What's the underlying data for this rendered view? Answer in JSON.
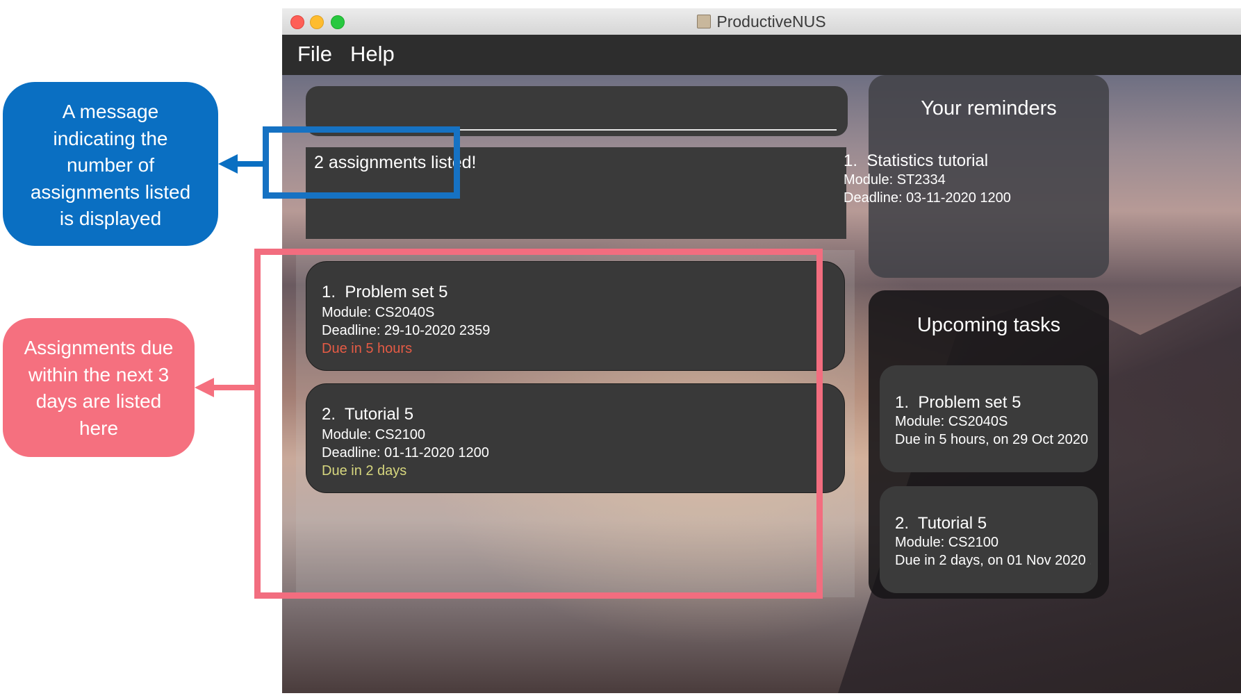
{
  "window": {
    "title": "ProductiveNUS"
  },
  "menu": {
    "items": [
      "File",
      "Help"
    ]
  },
  "command_box": {
    "value": ""
  },
  "result_display": {
    "text": "2 assignments listed!"
  },
  "assignment_list": [
    {
      "index": "1.",
      "name": "Problem set 5",
      "module": "Module: CS2040S",
      "deadline": "Deadline: 29-10-2020 2359",
      "due": "Due in 5 hours"
    },
    {
      "index": "2.",
      "name": "Tutorial 5",
      "module": "Module: CS2100",
      "deadline": "Deadline: 01-11-2020 1200",
      "due": "Due in 2 days"
    }
  ],
  "reminders": {
    "heading": "Your reminders",
    "items": [
      {
        "index": "1.",
        "name": "Statistics tutorial",
        "module": "Module: ST2334",
        "deadline": "Deadline: 03-11-2020 1200"
      }
    ]
  },
  "upcoming": {
    "heading": "Upcoming tasks",
    "items": [
      {
        "index": "1.",
        "name": "Problem set 5",
        "module": "Module: CS2040S",
        "due": "Due in 5 hours, on 29 Oct 2020 ..."
      },
      {
        "index": "2.",
        "name": "Tutorial 5",
        "module": "Module: CS2100",
        "due": "Due in 2 days, on 01 Nov 2020 ..."
      }
    ]
  },
  "annotations": {
    "blue_callout": [
      "A message",
      "indicating the",
      "number of",
      "assignments listed",
      "is displayed"
    ],
    "pink_callout": [
      "Assignments due",
      "within the next 3",
      "days are listed",
      "here"
    ]
  },
  "colors": {
    "due_urgent": "#e55b45",
    "due_soon": "#d6d67e",
    "callout_blue": "#0a6fc2",
    "callout_pink": "#f5707f"
  }
}
